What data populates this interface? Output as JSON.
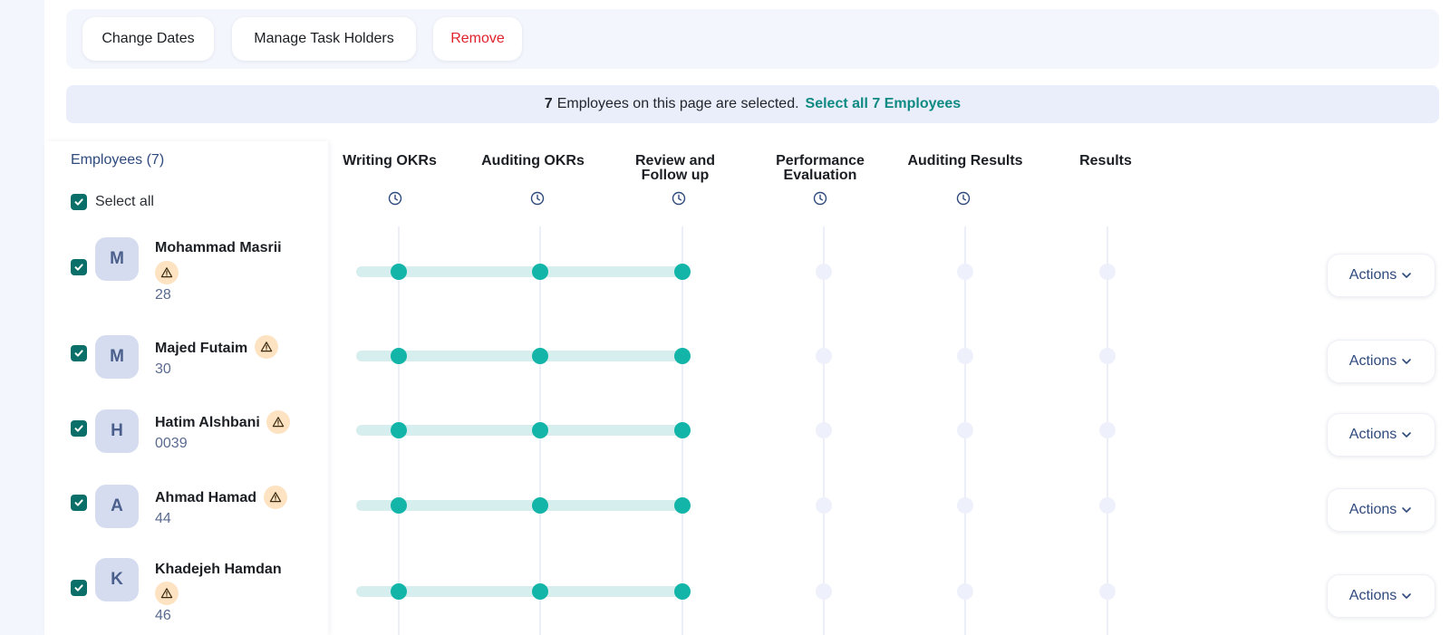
{
  "toolbar": {
    "change_dates": "Change Dates",
    "manage_task_holders": "Manage Task Holders",
    "remove": "Remove"
  },
  "banner": {
    "count": "7",
    "text": "Employees on this page are selected.",
    "select_all_link": "Select all 7 Employees"
  },
  "employees_panel": {
    "title": "Employees (7)",
    "select_all_label": "Select all"
  },
  "phases": [
    {
      "line1": "Writing OKRs",
      "line2": "",
      "has_clock": true
    },
    {
      "line1": "Auditing OKRs",
      "line2": "",
      "has_clock": true
    },
    {
      "line1": "Review and",
      "line2": "Follow up",
      "has_clock": true
    },
    {
      "line1": "Performance",
      "line2": "Evaluation",
      "has_clock": true
    },
    {
      "line1": "Auditing Results",
      "line2": "",
      "has_clock": true
    },
    {
      "line1": "Results",
      "line2": "",
      "has_clock": false
    }
  ],
  "employees": [
    {
      "initial": "M",
      "name": "Mohammad Masrii",
      "code": "28",
      "checked": true,
      "warning": true,
      "completed_phases": 3,
      "actions_label": "Actions"
    },
    {
      "initial": "M",
      "name": "Majed Futaim",
      "code": "30",
      "checked": true,
      "warning": true,
      "completed_phases": 3,
      "actions_label": "Actions"
    },
    {
      "initial": "H",
      "name": "Hatim Alshbani",
      "code": "0039",
      "checked": true,
      "warning": true,
      "completed_phases": 3,
      "actions_label": "Actions"
    },
    {
      "initial": "A",
      "name": "Ahmad Hamad",
      "code": "44",
      "checked": true,
      "warning": true,
      "completed_phases": 3,
      "actions_label": "Actions"
    },
    {
      "initial": "K",
      "name": "Khadejeh Hamdan",
      "code": "46",
      "checked": true,
      "warning": true,
      "completed_phases": 3,
      "actions_label": "Actions"
    }
  ],
  "colors": {
    "accent": "#0b6f69",
    "progress_dot": "#12b5a8",
    "danger": "#e0222a",
    "link": "#0e8a83"
  },
  "icons": {
    "checkbox": "check-icon",
    "warning": "warning-triangle-icon",
    "clock": "clock-icon",
    "actions": "chevron-down-icon"
  }
}
